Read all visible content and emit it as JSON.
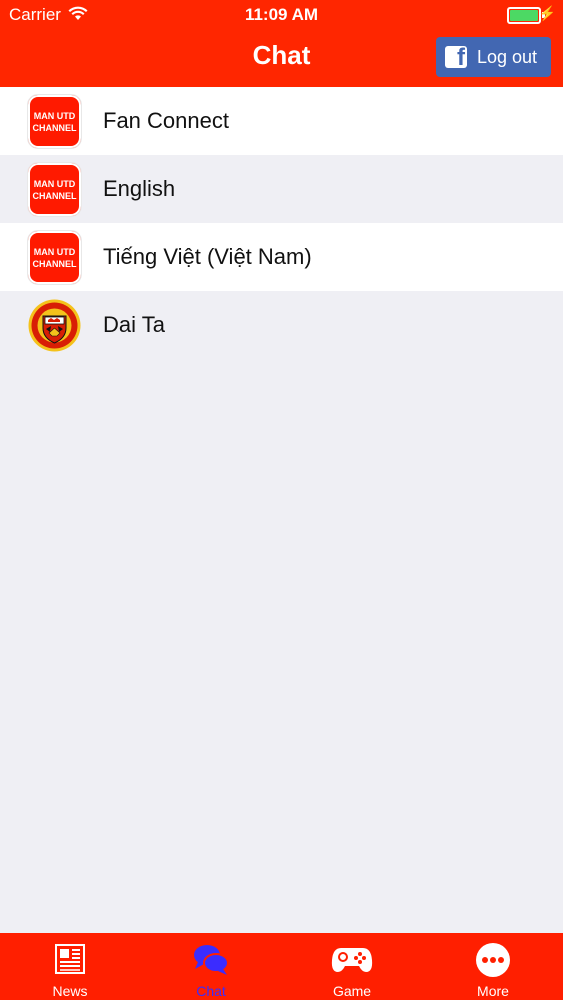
{
  "status_bar": {
    "carrier": "Carrier",
    "time": "11:09 AM"
  },
  "nav": {
    "title": "Chat",
    "logout_label": "Log out"
  },
  "chats": [
    {
      "label": "Fan Connect",
      "avatar": "man-utd-channel-logo",
      "logo_line1": "MAN UTD",
      "logo_line2": "CHANNEL"
    },
    {
      "label": "English",
      "avatar": "man-utd-channel-logo",
      "logo_line1": "MAN UTD",
      "logo_line2": "CHANNEL"
    },
    {
      "label": "Tiếng Việt (Việt Nam)",
      "avatar": "man-utd-channel-logo",
      "logo_line1": "MAN UTD",
      "logo_line2": "CHANNEL"
    },
    {
      "label": "Dai Ta",
      "avatar": "manchester-united-crest"
    }
  ],
  "tabs": [
    {
      "label": "News",
      "icon": "newspaper-icon"
    },
    {
      "label": "Chat",
      "icon": "chat-bubbles-icon",
      "active": true
    },
    {
      "label": "Game",
      "icon": "gamepad-icon"
    },
    {
      "label": "More",
      "icon": "more-dots-icon"
    }
  ],
  "colors": {
    "header": "#ff2600",
    "tabbar": "#ff1f00",
    "active_tab": "#3b2cff",
    "facebook": "#4267b2",
    "battery": "#4cd964"
  }
}
